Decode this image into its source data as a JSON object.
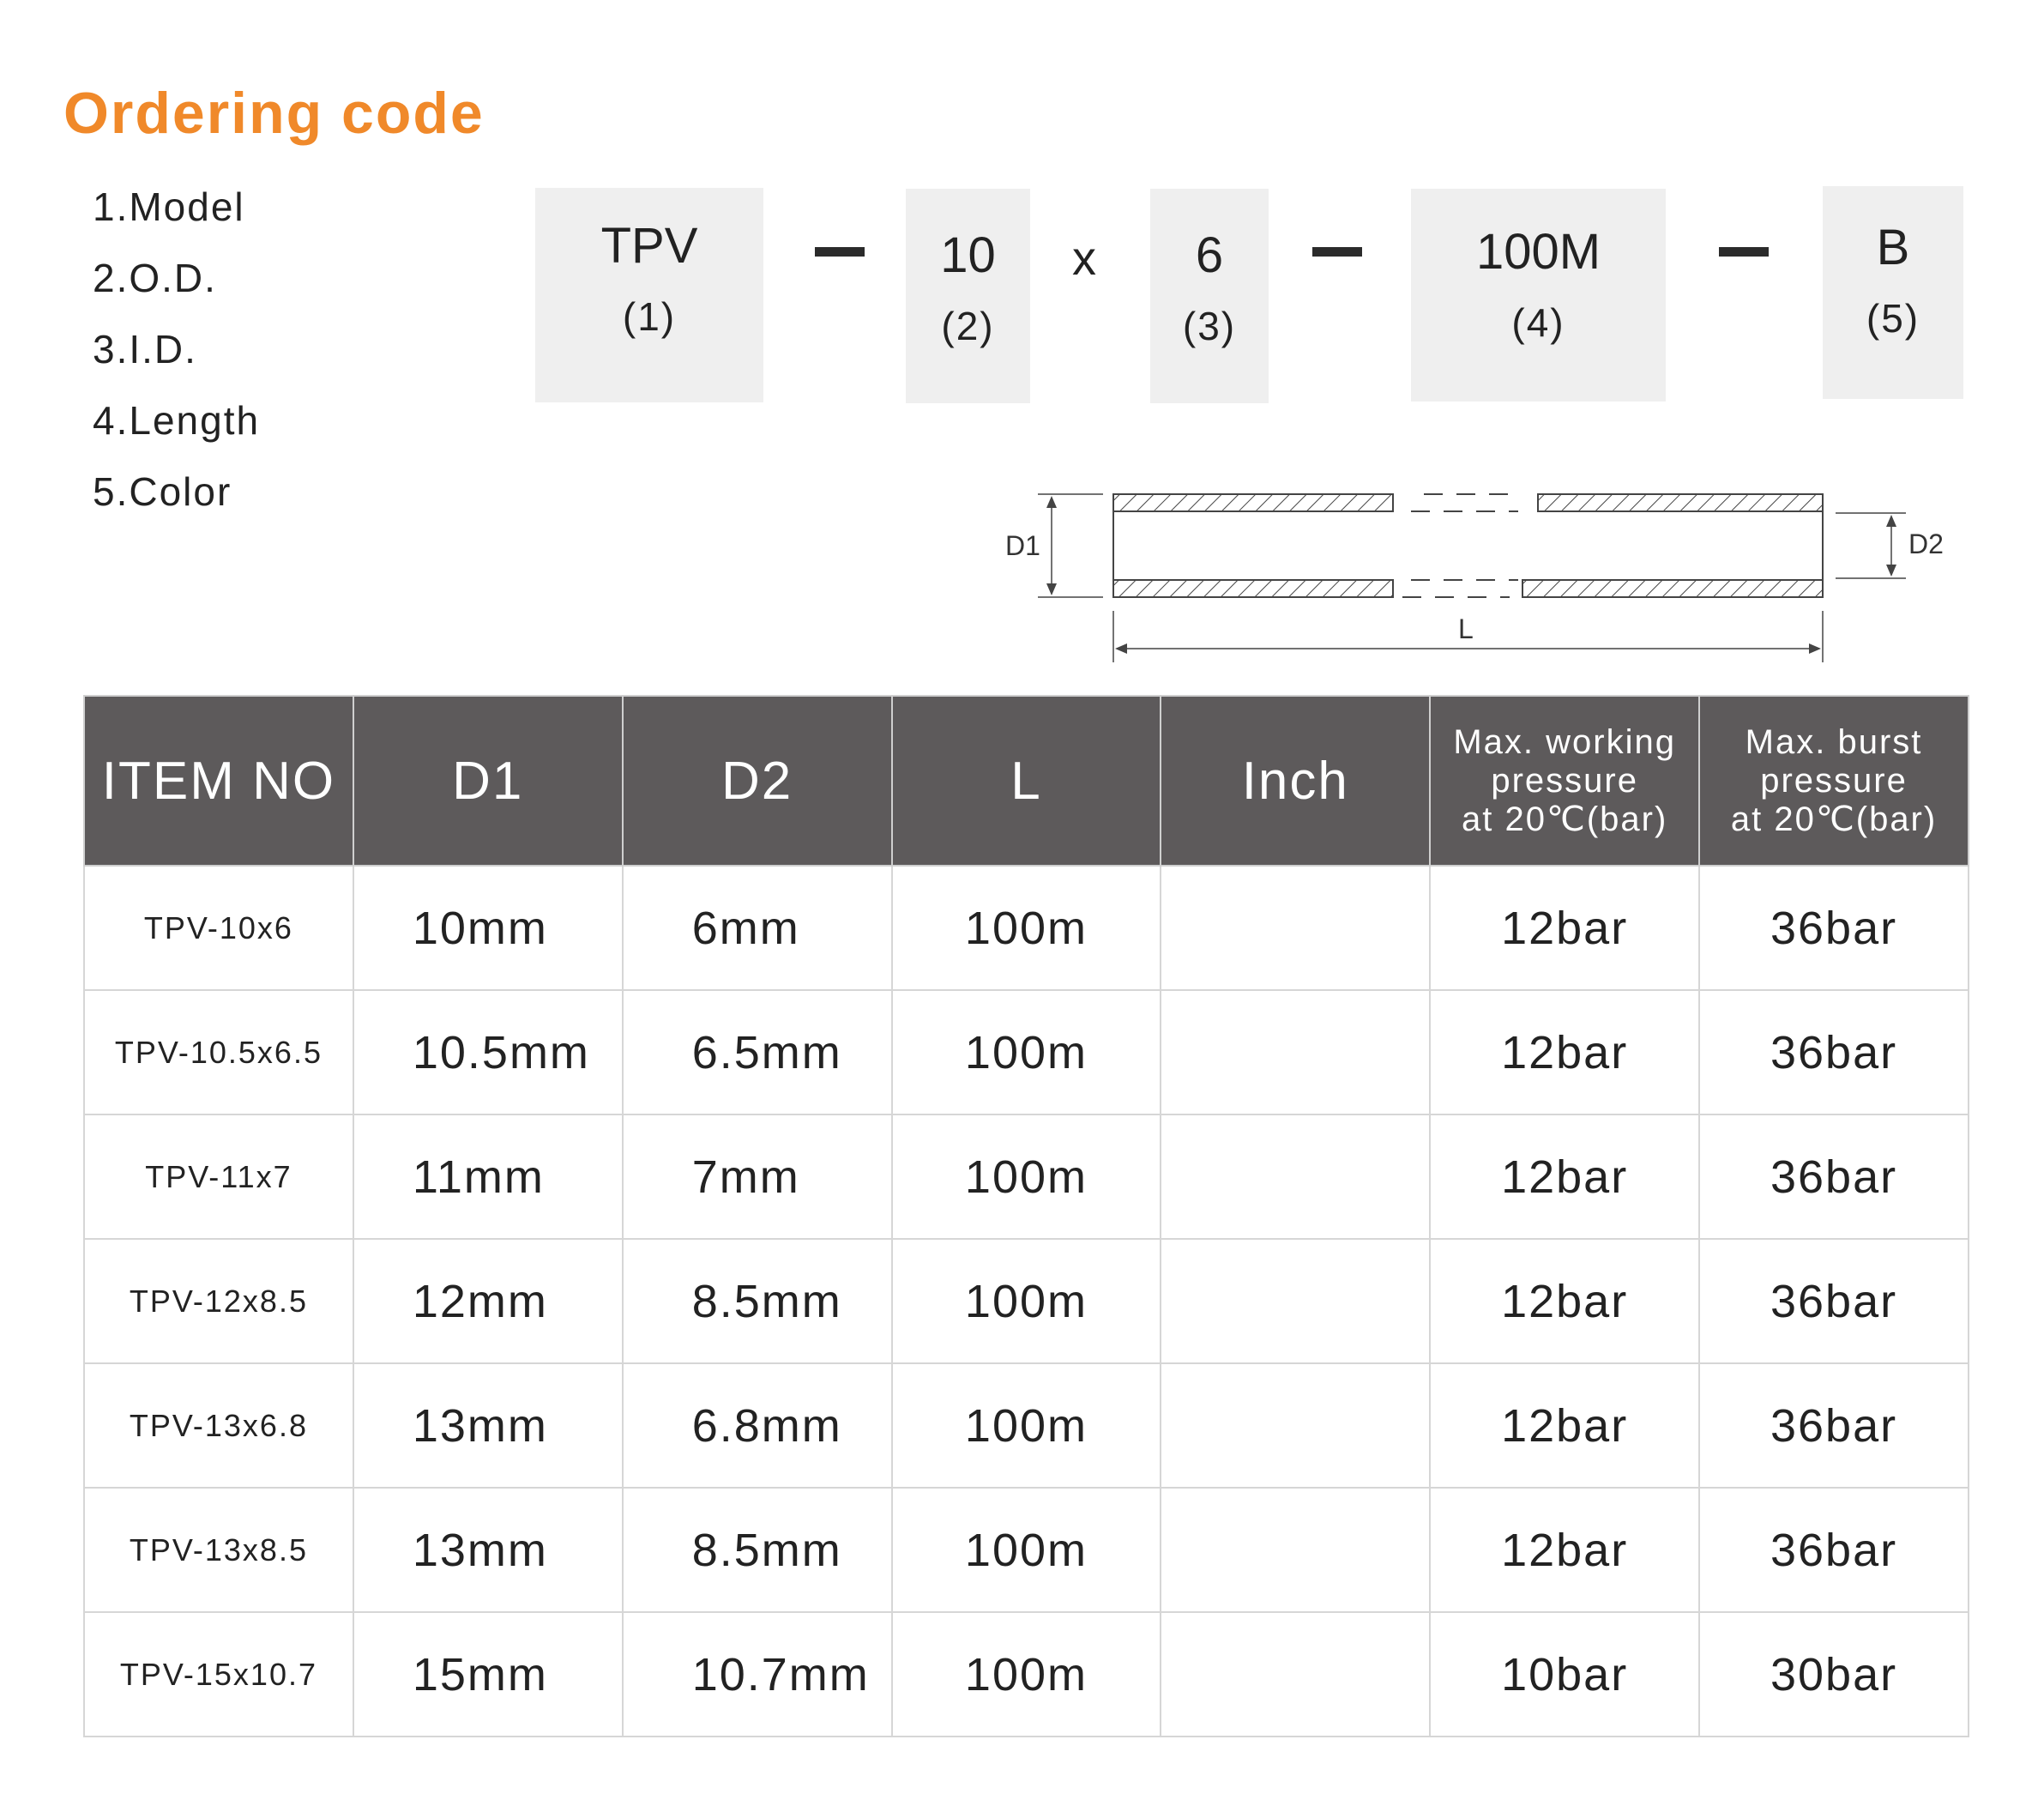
{
  "title": "Ordering code",
  "legend": [
    "1.Model",
    "2.O.D.",
    "3.I.D.",
    "4.Length",
    "5.Color"
  ],
  "code": {
    "segments": [
      {
        "code": "TPV",
        "num": "(1)"
      },
      {
        "code": "10",
        "num": "(2)"
      },
      {
        "code": "6",
        "num": "(3)"
      },
      {
        "code": "100M",
        "num": "(4)"
      },
      {
        "code": "B",
        "num": "(5)"
      }
    ],
    "times": "x"
  },
  "diagram": {
    "d1": "D1",
    "d2": "D2",
    "l": "L"
  },
  "table": {
    "headers": [
      "ITEM NO",
      "D1",
      "D2",
      "L",
      "Inch",
      "Max. working pressure at 20℃(bar)",
      "Max. burst pressure at 20℃(bar)"
    ],
    "header_lines": {
      "working": [
        "Max. working",
        "pressure",
        "at 20℃(bar)"
      ],
      "burst": [
        "Max. burst",
        "pressure",
        "at 20℃(bar)"
      ]
    },
    "rows": [
      {
        "item": "TPV-10x6",
        "d1": "10mm",
        "d2": "6mm",
        "l": "100m",
        "inch": "",
        "working": "12bar",
        "burst": "36bar"
      },
      {
        "item": "TPV-10.5x6.5",
        "d1": "10.5mm",
        "d2": "6.5mm",
        "l": "100m",
        "inch": "",
        "working": "12bar",
        "burst": "36bar"
      },
      {
        "item": "TPV-11x7",
        "d1": "11mm",
        "d2": "7mm",
        "l": "100m",
        "inch": "",
        "working": "12bar",
        "burst": "36bar"
      },
      {
        "item": "TPV-12x8.5",
        "d1": "12mm",
        "d2": "8.5mm",
        "l": "100m",
        "inch": "",
        "working": "12bar",
        "burst": "36bar"
      },
      {
        "item": "TPV-13x6.8",
        "d1": "13mm",
        "d2": "6.8mm",
        "l": "100m",
        "inch": "",
        "working": "12bar",
        "burst": "36bar"
      },
      {
        "item": "TPV-13x8.5",
        "d1": "13mm",
        "d2": "8.5mm",
        "l": "100m",
        "inch": "",
        "working": "12bar",
        "burst": "36bar"
      },
      {
        "item": "TPV-15x10.7",
        "d1": "15mm",
        "d2": "10.7mm",
        "l": "100m",
        "inch": "",
        "working": "10bar",
        "burst": "30bar"
      }
    ]
  },
  "colors": {
    "accent": "#f0892a",
    "header_bg": "#5d5a5b",
    "box_bg": "#efefef"
  }
}
